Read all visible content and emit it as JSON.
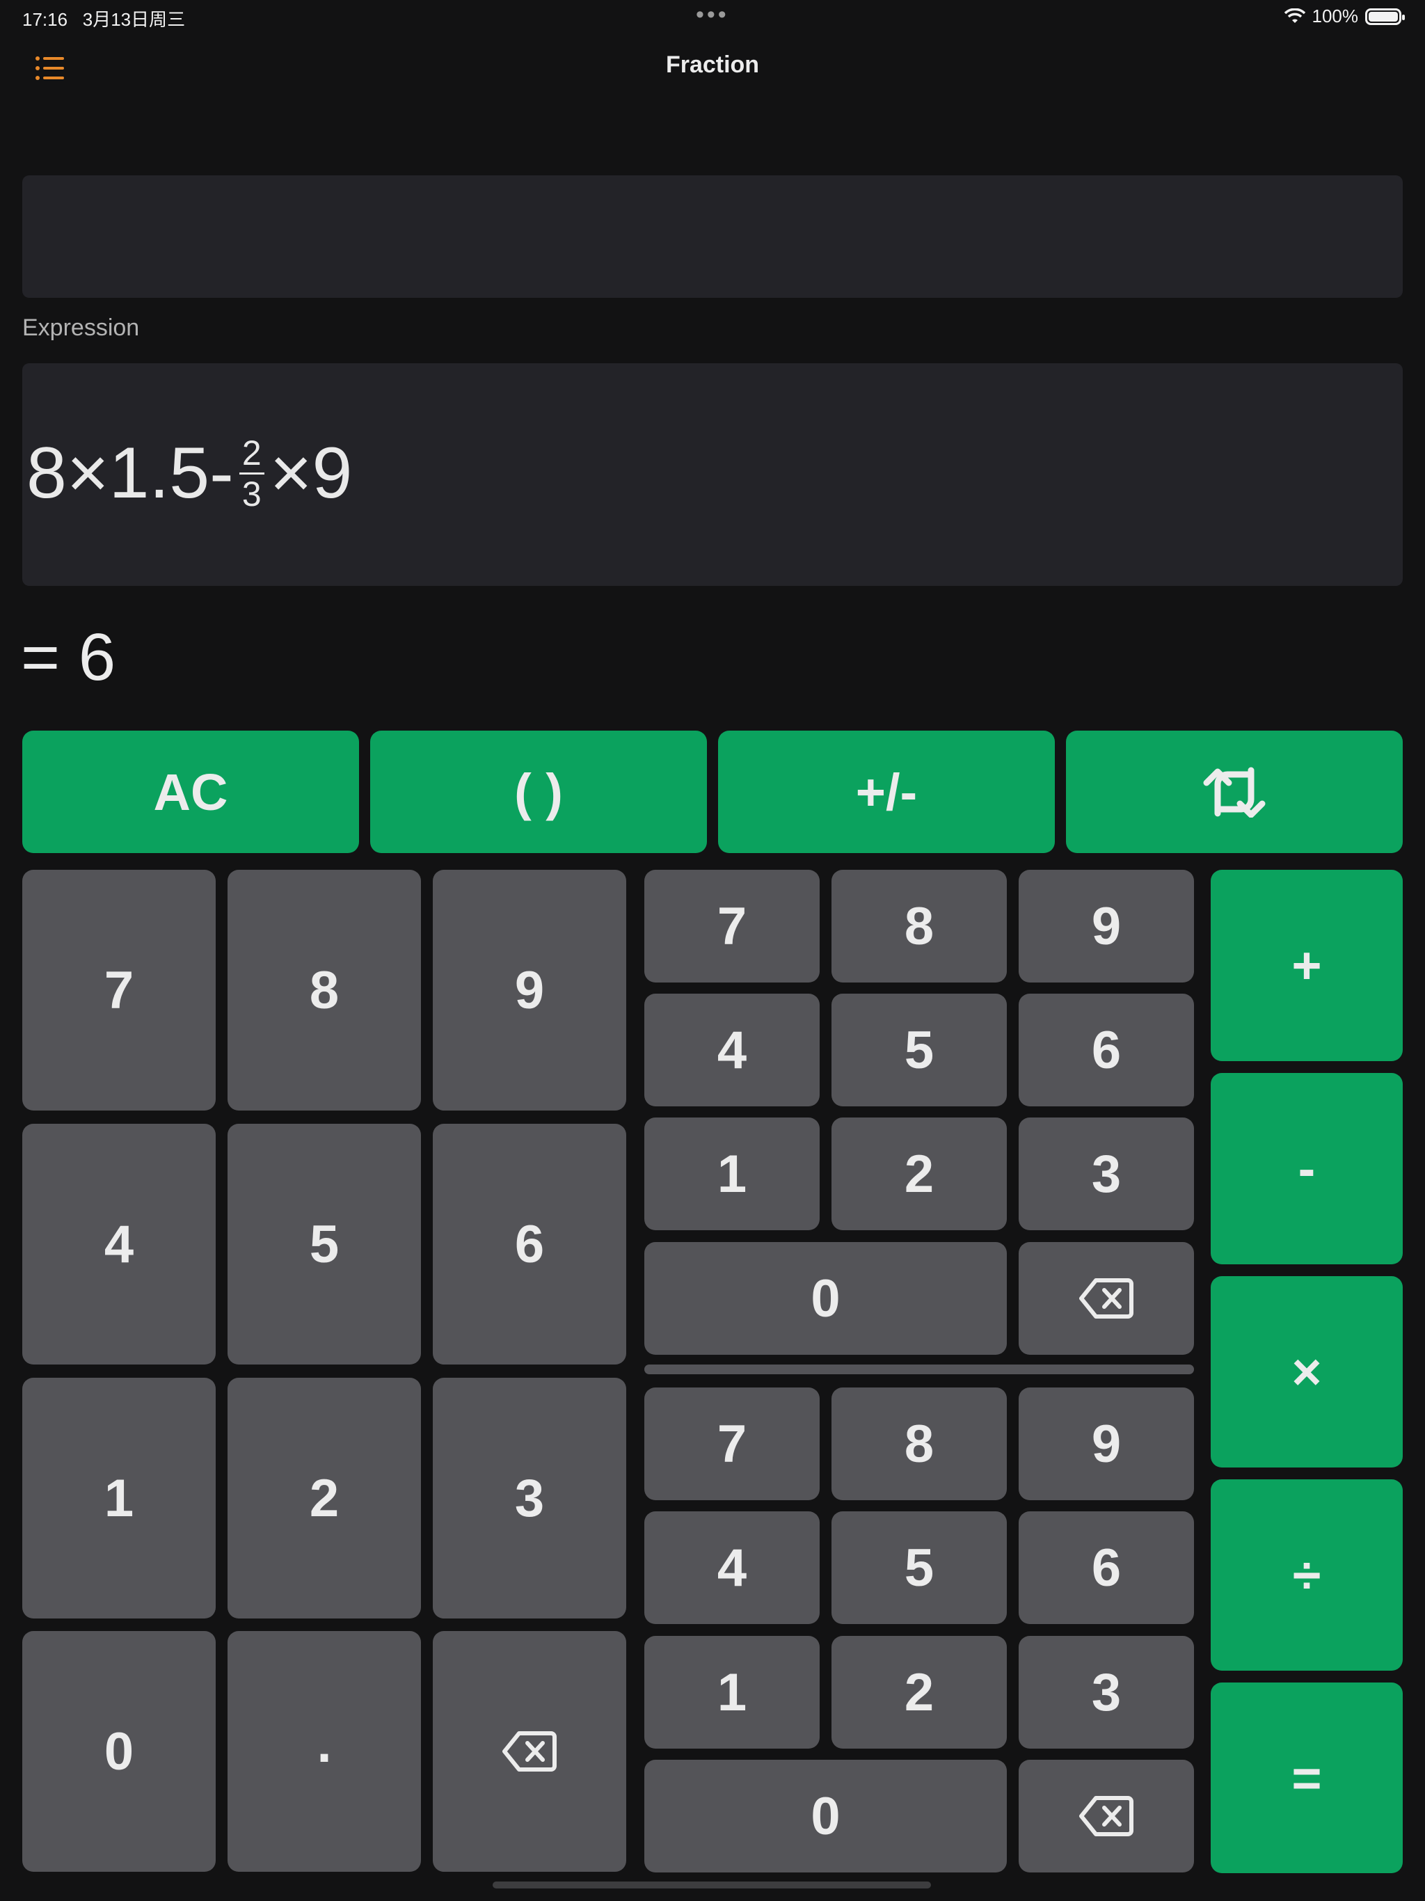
{
  "status_bar": {
    "time": "17:16",
    "date": "3月13日周三",
    "battery": "100%"
  },
  "header": {
    "title": "Fraction",
    "menu_icon": "list-icon"
  },
  "input_panel": {
    "value": ""
  },
  "expression": {
    "label": "Expression",
    "part1": "8×1.5-",
    "numerator": "2",
    "denominator": "3",
    "part2": "×9"
  },
  "result": "= 6",
  "top_row": [
    "AC",
    "( )",
    "+/-",
    "swap-icon"
  ],
  "main_keypad": [
    "7",
    "8",
    "9",
    "4",
    "5",
    "6",
    "1",
    "2",
    "3",
    "0",
    ".",
    "backspace-icon"
  ],
  "upper_keypad": [
    "7",
    "8",
    "9",
    "4",
    "5",
    "6",
    "1",
    "2",
    "3",
    "0",
    "backspace-icon"
  ],
  "lower_keypad": [
    "7",
    "8",
    "9",
    "4",
    "5",
    "6",
    "1",
    "2",
    "3",
    "0",
    "backspace-icon"
  ],
  "operators": [
    "+",
    "-",
    "×",
    "÷",
    "="
  ],
  "colors": {
    "accent_green": "#0ba25e",
    "key_grey": "#545458",
    "icon_orange": "#e8892a",
    "background": "#121213"
  }
}
